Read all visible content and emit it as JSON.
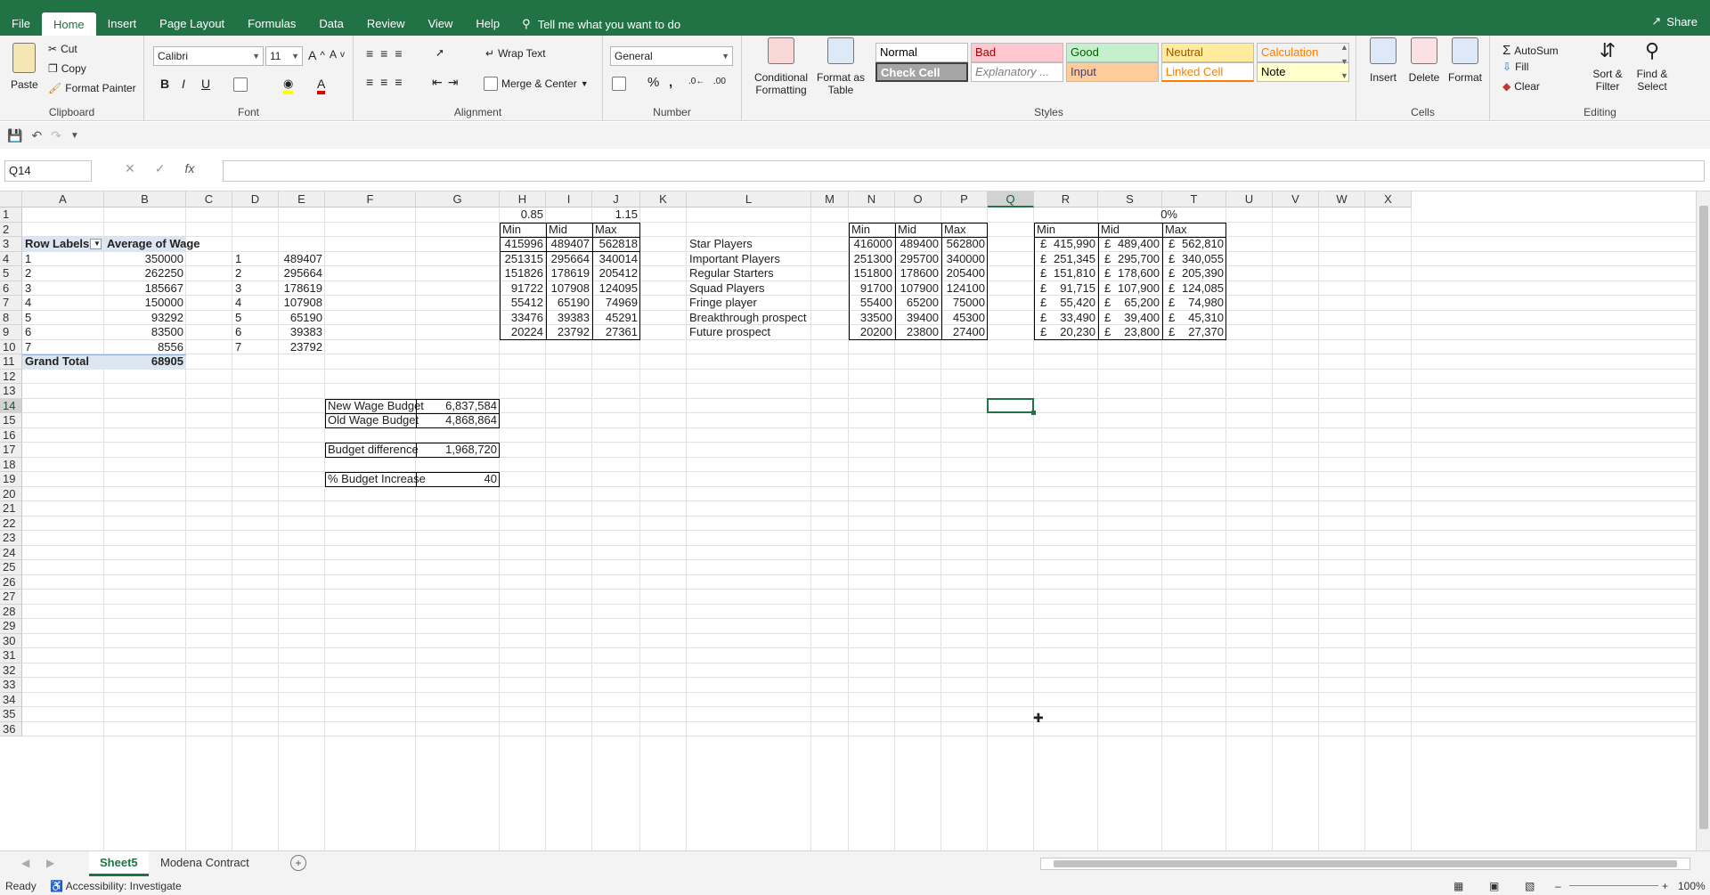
{
  "ribbon_tabs": [
    "File",
    "Home",
    "Insert",
    "Page Layout",
    "Formulas",
    "Data",
    "Review",
    "View",
    "Help"
  ],
  "tell_me": "Tell me what you want to do",
  "share": "Share",
  "clipboard": {
    "paste": "Paste",
    "cut": "Cut",
    "copy": "Copy",
    "format_painter": "Format Painter",
    "label": "Clipboard"
  },
  "font": {
    "name": "Calibri",
    "size": "11",
    "label": "Font"
  },
  "alignment": {
    "wrap": "Wrap Text",
    "merge": "Merge & Center",
    "label": "Alignment"
  },
  "number": {
    "format": "General",
    "label": "Number"
  },
  "styles": {
    "conditional": "Conditional Formatting",
    "format_table": "Format as Table",
    "label": "Styles",
    "cells": [
      {
        "name": "Normal",
        "bg": "#ffffff",
        "fg": "#000000"
      },
      {
        "name": "Bad",
        "bg": "#ffc7ce",
        "fg": "#9c0006"
      },
      {
        "name": "Good",
        "bg": "#c6efce",
        "fg": "#006100"
      },
      {
        "name": "Neutral",
        "bg": "#ffeb9c",
        "fg": "#9c5700"
      },
      {
        "name": "Calculation",
        "bg": "#f2f2f2",
        "fg": "#fa7d00"
      },
      {
        "name": "Check Cell",
        "bg": "#a5a5a5",
        "fg": "#ffffff"
      },
      {
        "name": "Explanatory ...",
        "bg": "#ffffff",
        "fg": "#7f7f7f"
      },
      {
        "name": "Input",
        "bg": "#ffcc99",
        "fg": "#3f3f76"
      },
      {
        "name": "Linked Cell",
        "bg": "#ffffff",
        "fg": "#fa7d00"
      },
      {
        "name": "Note",
        "bg": "#ffffcc",
        "fg": "#000000"
      }
    ]
  },
  "cells_group": {
    "insert": "Insert",
    "delete": "Delete",
    "format": "Format",
    "label": "Cells"
  },
  "editing": {
    "autosum": "AutoSum",
    "fill": "Fill",
    "clear": "Clear",
    "sort": "Sort & Filter",
    "find": "Find & Select",
    "label": "Editing"
  },
  "name_box": "Q14",
  "formula": "",
  "columns": [
    "A",
    "B",
    "C",
    "D",
    "E",
    "F",
    "G",
    "H",
    "I",
    "J",
    "K",
    "L",
    "M",
    "N",
    "O",
    "P",
    "Q",
    "R",
    "S",
    "T",
    "U",
    "V",
    "W",
    "X"
  ],
  "selected_column": "Q",
  "selected_row": 14,
  "rows": [
    1,
    2,
    3,
    4,
    5,
    6,
    7,
    8,
    9,
    10,
    11,
    12,
    13,
    14,
    15,
    16,
    17,
    18,
    19,
    20,
    21,
    22,
    23,
    24,
    25,
    26,
    27,
    28,
    29,
    30,
    31,
    32,
    33,
    34,
    35,
    36
  ],
  "pivot": {
    "header_row_labels": "Row Labels",
    "header_avg": "Average of Wage",
    "rows": [
      [
        "1",
        "350000"
      ],
      [
        "2",
        "262250"
      ],
      [
        "3",
        "185667"
      ],
      [
        "4",
        "150000"
      ],
      [
        "5",
        "93292"
      ],
      [
        "6",
        "83500"
      ],
      [
        "7",
        "8556"
      ]
    ],
    "grand_total_label": "Grand Total",
    "grand_total_value": "68905"
  },
  "col_de": [
    [
      "1",
      "489407"
    ],
    [
      "2",
      "295664"
    ],
    [
      "3",
      "178619"
    ],
    [
      "4",
      "107908"
    ],
    [
      "5",
      "65190"
    ],
    [
      "6",
      "39383"
    ],
    [
      "7",
      "23792"
    ]
  ],
  "factors": {
    "h1": "0.85",
    "j1": "1.15",
    "s1": "0%"
  },
  "range_headers": [
    "Min",
    "Mid",
    "Max"
  ],
  "hij": [
    [
      "415996",
      "489407",
      "562818"
    ],
    [
      "251315",
      "295664",
      "340014"
    ],
    [
      "151826",
      "178619",
      "205412"
    ],
    [
      "91722",
      "107908",
      "124095"
    ],
    [
      "55412",
      "65190",
      "74969"
    ],
    [
      "33476",
      "39383",
      "45291"
    ],
    [
      "20224",
      "23792",
      "27361"
    ]
  ],
  "categories": [
    "Star Players",
    "Important Players",
    "Regular Starters",
    "Squad Players",
    "Fringe player",
    "Breakthrough prospect",
    "Future prospect"
  ],
  "nop": [
    [
      "416000",
      "489400",
      "562800"
    ],
    [
      "251300",
      "295700",
      "340000"
    ],
    [
      "151800",
      "178600",
      "205400"
    ],
    [
      "91700",
      "107900",
      "124100"
    ],
    [
      "55400",
      "65200",
      "75000"
    ],
    [
      "33500",
      "39400",
      "45300"
    ],
    [
      "20200",
      "23800",
      "27400"
    ]
  ],
  "currency_symbol": "£",
  "rst": [
    [
      "415,990",
      "489,400",
      "562,810"
    ],
    [
      "251,345",
      "295,700",
      "340,055"
    ],
    [
      "151,810",
      "178,600",
      "205,390"
    ],
    [
      "91,715",
      "107,900",
      "124,085"
    ],
    [
      "55,420",
      "65,200",
      "74,980"
    ],
    [
      "33,490",
      "39,400",
      "45,310"
    ],
    [
      "20,230",
      "23,800",
      "27,370"
    ]
  ],
  "budget": {
    "new_label": "New Wage Budget",
    "new_value": "6,837,584",
    "old_label": "Old Wage Budget",
    "old_value": "4,868,864",
    "diff_label": "Budget difference",
    "diff_value": "1,968,720",
    "pct_label": "% Budget Increase",
    "pct_value": "40"
  },
  "sheets": [
    "Sheet5",
    "Modena Contract"
  ],
  "status": {
    "ready": "Ready",
    "accessibility": "Accessibility: Investigate",
    "zoom": "100%"
  }
}
